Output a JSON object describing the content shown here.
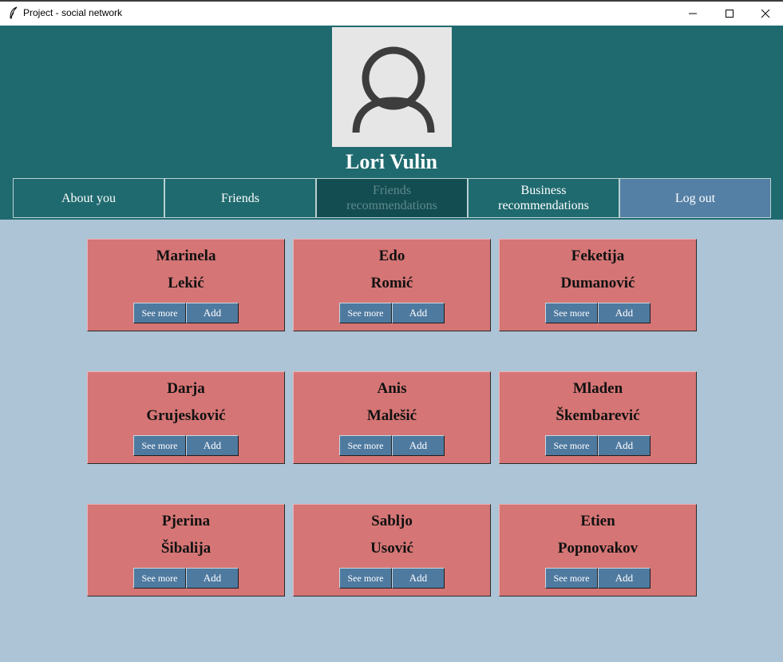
{
  "window": {
    "title": "Project - social network",
    "icons": [
      "feather-icon",
      "minimize-icon",
      "maximize-icon",
      "close-icon"
    ]
  },
  "profile": {
    "name": "Lori Vulin",
    "avatar_icon": "user-placeholder-icon"
  },
  "nav": [
    {
      "label": "About you",
      "state": "normal"
    },
    {
      "label": "Friends",
      "state": "normal"
    },
    {
      "label": "Friends\nrecommendations",
      "state": "active"
    },
    {
      "label": "Business\nrecommendations",
      "state": "normal"
    },
    {
      "label": "Log out",
      "state": "normal"
    }
  ],
  "card_actions": {
    "see_more": "See more",
    "add": "Add"
  },
  "recommendations": [
    {
      "first": "Marinela",
      "last": "Lekić"
    },
    {
      "first": "Edo",
      "last": "Romić"
    },
    {
      "first": "Feketija",
      "last": "Dumanović"
    },
    {
      "first": "Darja",
      "last": "Grujesković"
    },
    {
      "first": "Anis",
      "last": "Malešić"
    },
    {
      "first": "Mladen",
      "last": "Škembarević"
    },
    {
      "first": "Pjerina",
      "last": "Šibalija"
    },
    {
      "first": "Sabljo",
      "last": "Usović"
    },
    {
      "first": "Etien",
      "last": "Popnovakov"
    }
  ],
  "colors": {
    "header": "#1f6a6f",
    "background": "#adc3d6",
    "card": "#d57575",
    "button": "#4f7aa0",
    "active_nav": "#134d52",
    "logout": "#5580a6"
  }
}
